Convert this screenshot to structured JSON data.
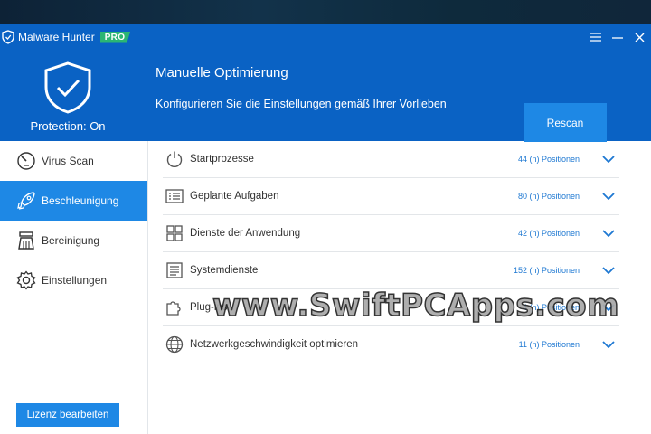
{
  "app": {
    "title": "Malware Hunter",
    "badge": "PRO"
  },
  "header": {
    "protection_status": "Protection: On",
    "title": "Manuelle Optimierung",
    "subtitle": "Konfigurieren Sie die Einstellungen gemäß Ihrer Vorlieben",
    "rescan_label": "Rescan"
  },
  "sidebar": {
    "items": [
      {
        "label": "Virus Scan",
        "icon": "gauge-icon",
        "active": false
      },
      {
        "label": "Beschleunigung",
        "icon": "rocket-icon",
        "active": true
      },
      {
        "label": "Bereinigung",
        "icon": "broom-icon",
        "active": false
      },
      {
        "label": "Einstellungen",
        "icon": "gear-icon",
        "active": false
      }
    ],
    "license_button": "Lizenz bearbeiten"
  },
  "rows": [
    {
      "label": "Startprozesse",
      "count": "44 (n) Positionen",
      "icon": "power-icon"
    },
    {
      "label": "Geplante Aufgaben",
      "count": "80 (n) Positionen",
      "icon": "task-list-icon"
    },
    {
      "label": "Dienste der Anwendung",
      "count": "42 (n) Positionen",
      "icon": "grid-icon"
    },
    {
      "label": "Systemdienste",
      "count": "152 (n) Positionen",
      "icon": "document-icon"
    },
    {
      "label": "Plug-ins",
      "count": "4 (n) Positionen",
      "icon": "puzzle-icon"
    },
    {
      "label": "Netzwerkgeschwindigkeit optimieren",
      "count": "11 (n) Positionen",
      "icon": "globe-icon"
    }
  ],
  "watermark": "www.SwiftPCApps.com",
  "colors": {
    "primary": "#0a62c4",
    "accent": "#1e88e5",
    "badge": "#2bb673"
  }
}
